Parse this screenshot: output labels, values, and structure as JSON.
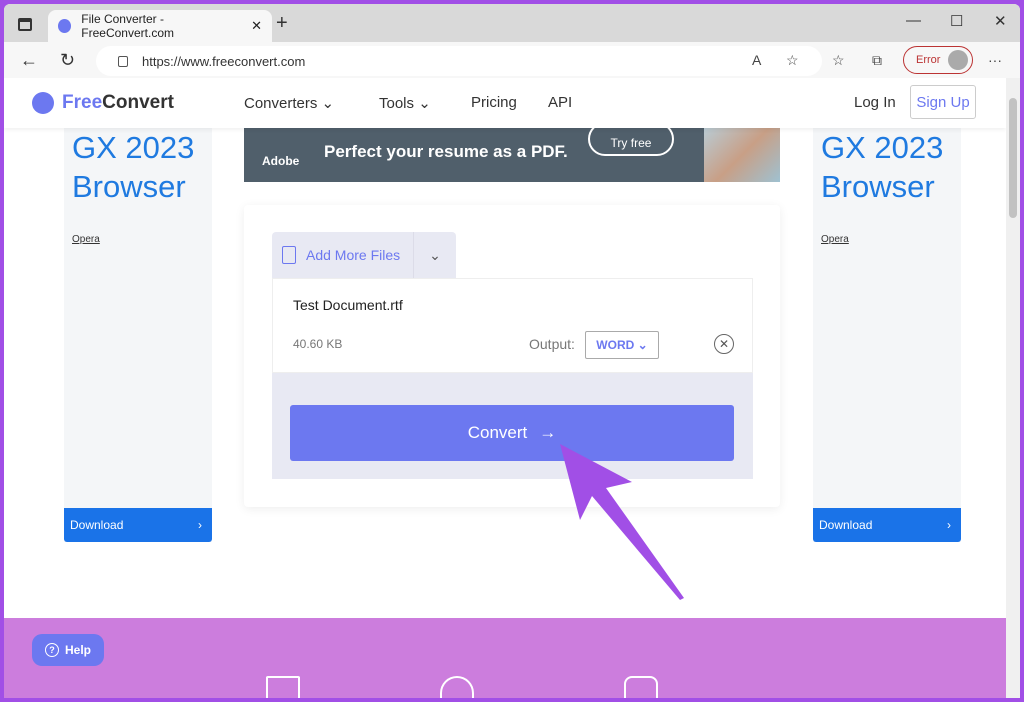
{
  "browser": {
    "tab_title": "File Converter - FreeConvert.com",
    "url": "https://www.freeconvert.com",
    "profile_status": "Error"
  },
  "header": {
    "logo_free": "Free",
    "logo_convert": "Convert",
    "menu": [
      "Converters",
      "Tools",
      "Pricing",
      "API"
    ],
    "login": "Log In",
    "signup": "Sign Up"
  },
  "ads": {
    "side_title_1": "GX 2023",
    "side_title_2": "Browser",
    "side_brand": "Opera",
    "side_button": "Download",
    "banner_brand": "Adobe",
    "banner_text": "Perfect your resume as a PDF.",
    "banner_button": "Try free"
  },
  "converter": {
    "add_files": "Add More Files",
    "file_name": "Test Document.rtf",
    "file_size": "40.60 KB",
    "output_label": "Output:",
    "output_format": "WORD",
    "convert_button": "Convert"
  },
  "footer": {
    "help": "Help"
  },
  "colors": {
    "accent": "#6c78f0",
    "footer": "#cc7ddd",
    "annotation_arrow": "#a14fe6",
    "ad_blue": "#1a73e8"
  }
}
